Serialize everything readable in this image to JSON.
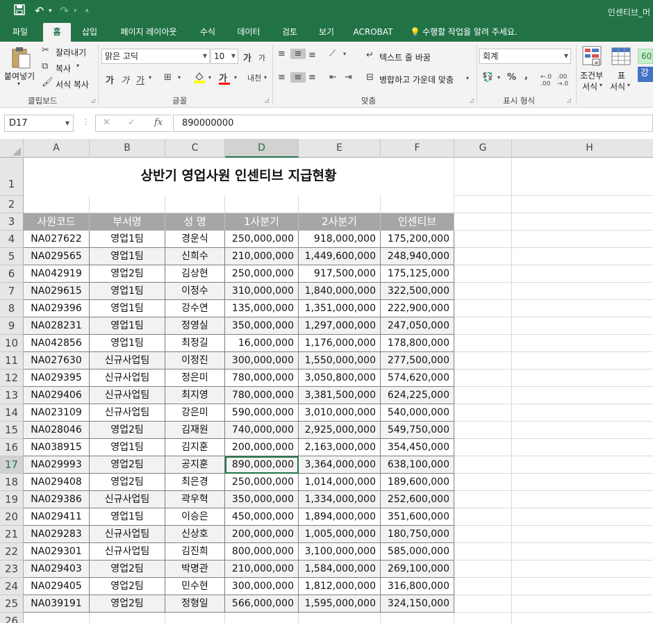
{
  "window": {
    "title": "인센티브_머"
  },
  "quick_access": {
    "save_icon": "save-icon",
    "undo_icon": "undo-icon",
    "redo_icon": "redo-icon",
    "customize_icon": "chevron-down-icon"
  },
  "menu": {
    "tabs": [
      "파일",
      "홈",
      "삽입",
      "페이지 레이아웃",
      "수식",
      "데이터",
      "검토",
      "보기",
      "ACROBAT"
    ],
    "active": "홈",
    "tell_me": "수행할 작업을 알려 주세요."
  },
  "ribbon": {
    "clipboard": {
      "label": "클립보드",
      "paste": "붙여넣기",
      "cut": "잘라내기",
      "copy": "복사",
      "format_painter": "서식 복사"
    },
    "font": {
      "label": "글꼴",
      "name": "맑은 고딕",
      "size": "10",
      "grow": "가",
      "shrink": "가",
      "bold": "가",
      "italic": "가",
      "underline": "가",
      "font_color_glyph": "가",
      "phonetic": "내천"
    },
    "alignment": {
      "label": "맞춤",
      "wrap": "텍스트 줄 바꿈",
      "merge": "병합하고 가운데 맞춤"
    },
    "number": {
      "label": "표시 형식",
      "format": "회계",
      "percent": "%",
      "comma": ",",
      "inc_dec": "←.0 .00",
      "dec_dec": ".00 →.0"
    },
    "styles": {
      "conditional_1": "조건부",
      "conditional_2": "서식",
      "table_1": "표",
      "table_2": "서식",
      "style_top": "60",
      "style_bottom": "강"
    }
  },
  "formula_bar": {
    "name_box": "D17",
    "cancel": "✕",
    "enter": "✓",
    "fx": "fx",
    "value": "890000000"
  },
  "sheet": {
    "columns": [
      "A",
      "B",
      "C",
      "D",
      "E",
      "F",
      "G",
      "H"
    ],
    "rows": [
      "1",
      "2",
      "3",
      "4",
      "5",
      "6",
      "7",
      "8",
      "9",
      "10",
      "11",
      "12",
      "13",
      "14",
      "15",
      "16",
      "17",
      "18",
      "19",
      "20",
      "21",
      "22",
      "23",
      "24",
      "25",
      "26"
    ],
    "title": "상반기 영업사원 인센티브 지급현황",
    "headers": [
      "사원코드",
      "부서명",
      "성  명",
      "1사분기",
      "2사분기",
      "인센티브"
    ],
    "data": [
      [
        "NA027622",
        "영업1팀",
        "경운식",
        "250,000,000",
        "918,000,000",
        "175,200,000"
      ],
      [
        "NA029565",
        "영업1팀",
        "신희수",
        "210,000,000",
        "1,449,600,000",
        "248,940,000"
      ],
      [
        "NA042919",
        "영업2팀",
        "김상현",
        "250,000,000",
        "917,500,000",
        "175,125,000"
      ],
      [
        "NA029615",
        "영업1팀",
        "이정수",
        "310,000,000",
        "1,840,000,000",
        "322,500,000"
      ],
      [
        "NA029396",
        "영업1팀",
        "강수연",
        "135,000,000",
        "1,351,000,000",
        "222,900,000"
      ],
      [
        "NA028231",
        "영업1팀",
        "정영실",
        "350,000,000",
        "1,297,000,000",
        "247,050,000"
      ],
      [
        "NA042856",
        "영업1팀",
        "최정길",
        "16,000,000",
        "1,176,000,000",
        "178,800,000"
      ],
      [
        "NA027630",
        "신규사업팀",
        "이정진",
        "300,000,000",
        "1,550,000,000",
        "277,500,000"
      ],
      [
        "NA029395",
        "신규사업팀",
        "정은미",
        "780,000,000",
        "3,050,800,000",
        "574,620,000"
      ],
      [
        "NA029406",
        "신규사업팀",
        "최지영",
        "780,000,000",
        "3,381,500,000",
        "624,225,000"
      ],
      [
        "NA023109",
        "신규사업팀",
        "강은미",
        "590,000,000",
        "3,010,000,000",
        "540,000,000"
      ],
      [
        "NA028046",
        "영업2팀",
        "김재원",
        "740,000,000",
        "2,925,000,000",
        "549,750,000"
      ],
      [
        "NA038915",
        "영업1팀",
        "김지훈",
        "200,000,000",
        "2,163,000,000",
        "354,450,000"
      ],
      [
        "NA029993",
        "영업2팀",
        "공지훈",
        "890,000,000",
        "3,364,000,000",
        "638,100,000"
      ],
      [
        "NA029408",
        "영업2팀",
        "최은경",
        "250,000,000",
        "1,014,000,000",
        "189,600,000"
      ],
      [
        "NA029386",
        "신규사업팀",
        "곽우혁",
        "350,000,000",
        "1,334,000,000",
        "252,600,000"
      ],
      [
        "NA029411",
        "영업1팀",
        "이승은",
        "450,000,000",
        "1,894,000,000",
        "351,600,000"
      ],
      [
        "NA029283",
        "신규사업팀",
        "신상호",
        "200,000,000",
        "1,005,000,000",
        "180,750,000"
      ],
      [
        "NA029301",
        "신규사업팀",
        "김진희",
        "800,000,000",
        "3,100,000,000",
        "585,000,000"
      ],
      [
        "NA029403",
        "영업2팀",
        "박명관",
        "210,000,000",
        "1,584,000,000",
        "269,100,000"
      ],
      [
        "NA029405",
        "영업2팀",
        "민수현",
        "300,000,000",
        "1,812,000,000",
        "316,800,000"
      ],
      [
        "NA039191",
        "영업2팀",
        "정형일",
        "566,000,000",
        "1,595,000,000",
        "324,150,000"
      ]
    ]
  },
  "colors": {
    "brand": "#217346",
    "header_fill": "#a6a6a6",
    "band_fill": "#f2f2f2"
  }
}
